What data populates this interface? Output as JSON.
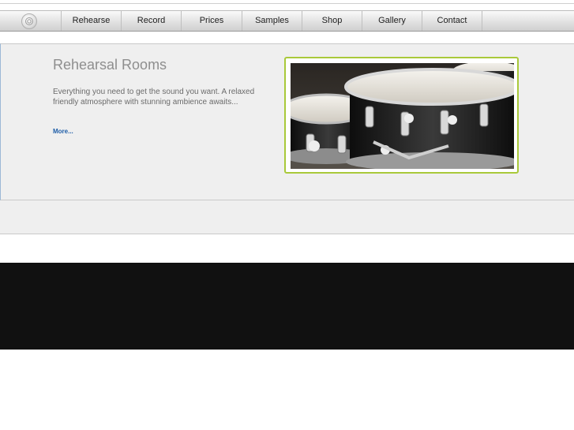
{
  "nav": {
    "items": [
      {
        "label": "Rehearse"
      },
      {
        "label": "Record"
      },
      {
        "label": "Prices"
      },
      {
        "label": "Samples"
      },
      {
        "label": "Shop"
      },
      {
        "label": "Gallery"
      },
      {
        "label": "Contact"
      }
    ]
  },
  "hero": {
    "title": "Rehearsal Rooms",
    "description": "Everything you need to get the sound you want. A relaxed friendly atmosphere with stunning ambience awaits...",
    "more_link": "More...",
    "photo_subject": "drum-kit-photo"
  },
  "colors": {
    "accent_frame": "#a9c93a",
    "link": "#1f5ea8",
    "footer": "#111111"
  }
}
